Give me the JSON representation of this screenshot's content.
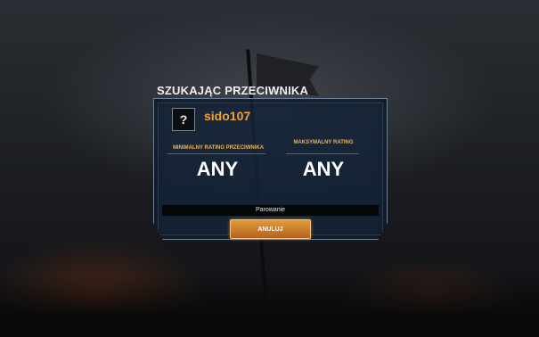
{
  "dialog": {
    "title": "SZUKAJĄC PRZECIWNIKA",
    "avatar_symbol": "?",
    "username": "sido107",
    "min_rating_label": "MINIMALNY RATING PRZECIWNIKA",
    "min_rating_value": "ANY",
    "max_rating_label": "MAKSYMALNY RATING",
    "max_rating_value": "ANY",
    "status_text": "Parowanie",
    "cancel_label": "ANULUJ"
  },
  "colors": {
    "accent_orange": "#f0a33a",
    "panel_blue": "#142438",
    "label_gold": "#e8b35c"
  }
}
